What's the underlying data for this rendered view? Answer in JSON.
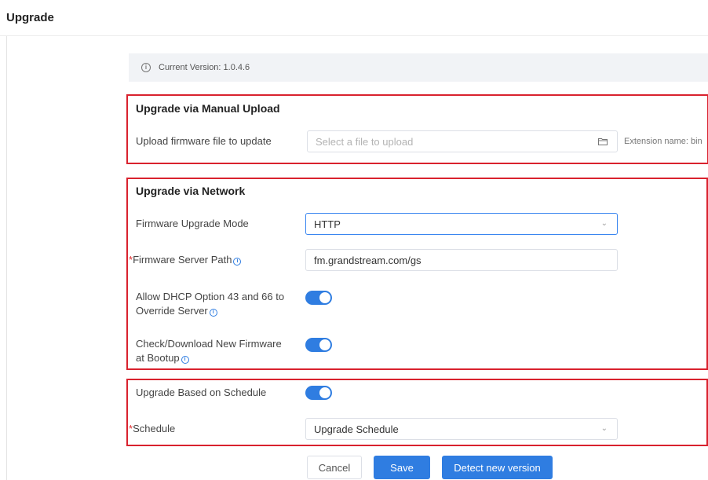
{
  "page": {
    "title": "Upgrade"
  },
  "info": {
    "current_version": "Current Version: 1.0.4.6"
  },
  "manual_upload": {
    "title": "Upgrade via Manual Upload",
    "upload_label": "Upload firmware file to update",
    "upload_placeholder": "Select a file to upload",
    "extension_hint": "Extension name: bin"
  },
  "network": {
    "title": "Upgrade via Network",
    "mode_label": "Firmware Upgrade Mode",
    "mode_value": "HTTP",
    "server_path_label": "Firmware Server Path",
    "server_path_value": "fm.grandstream.com/gs",
    "dhcp_label_line1": "Allow DHCP Option 43 and 66 to",
    "dhcp_label_line2": "Override Server",
    "dhcp_enabled": true,
    "bootup_label_line1": "Check/Download New Firmware",
    "bootup_label_line2": "at Bootup",
    "bootup_enabled": true
  },
  "schedule": {
    "based_label": "Upgrade Based on Schedule",
    "based_enabled": true,
    "schedule_label": "Schedule",
    "schedule_value": "Upgrade Schedule"
  },
  "buttons": {
    "cancel": "Cancel",
    "save": "Save",
    "detect": "Detect new version"
  },
  "colors": {
    "accent": "#2f7de1",
    "highlight_box": "#d9222e",
    "required": "#e03030"
  },
  "icons": {
    "info": "info-icon",
    "help": "help-icon",
    "folder": "folder-icon",
    "dropdown": "chevron-down-icon"
  }
}
